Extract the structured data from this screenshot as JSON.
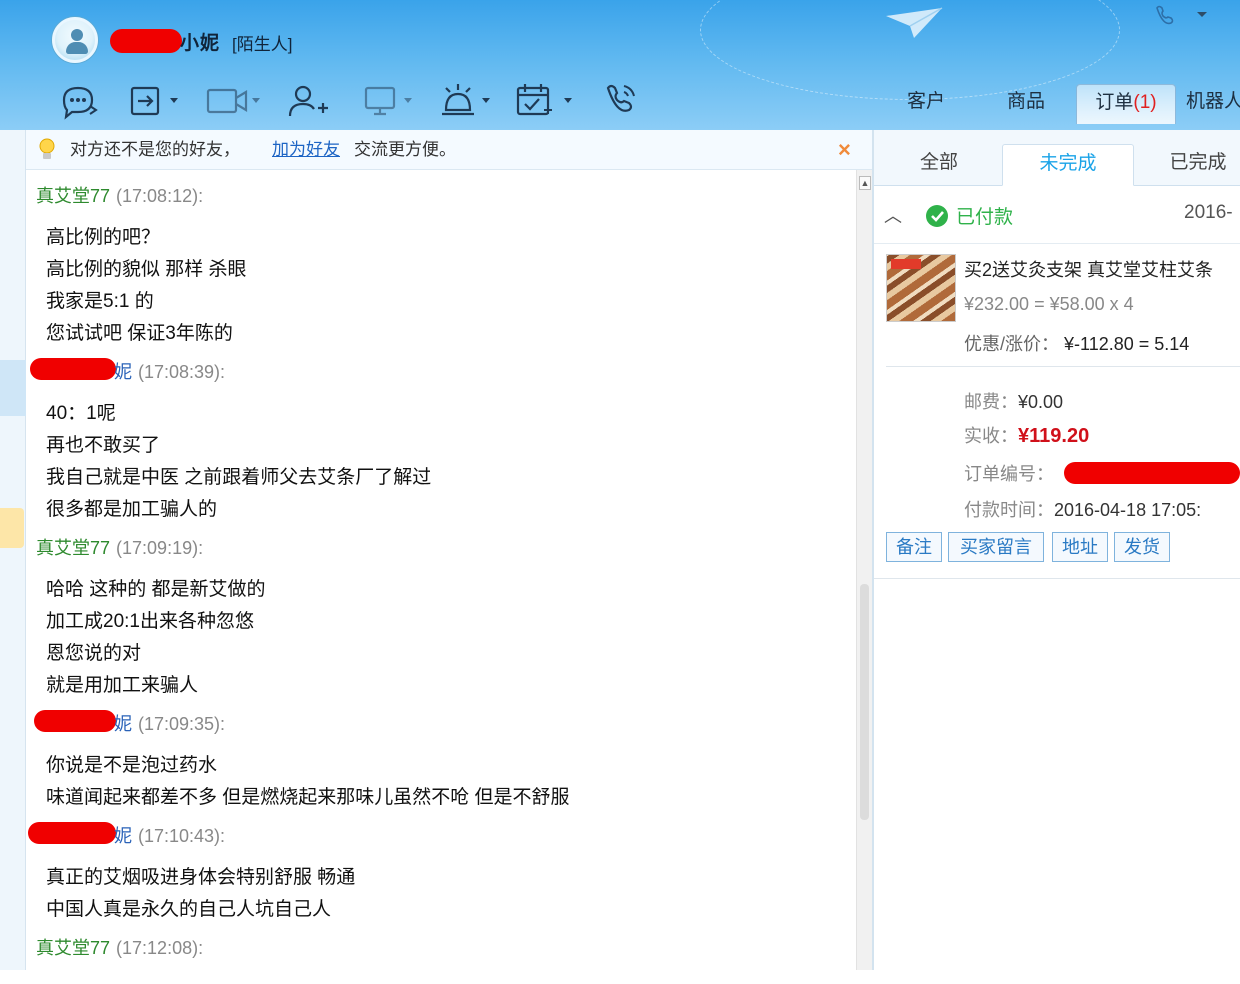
{
  "header": {
    "contact_name": "小妮",
    "contact_tag": "[陌生人]",
    "toolbar_icons": [
      "chat-bubble-icon",
      "file-transfer-icon",
      "video-icon",
      "add-friend-icon",
      "screen-share-icon",
      "remote-assist-icon",
      "schedule-icon",
      "phone-icon"
    ],
    "tabs": [
      {
        "label": "客户"
      },
      {
        "label": "商品"
      },
      {
        "label": "订单",
        "badge": "(1)"
      },
      {
        "label": "机器人"
      }
    ]
  },
  "notice": {
    "text_before": "对方还不是您的好友，",
    "link": "加为好友",
    "text_after": "交流更方便。",
    "close": "×"
  },
  "messages": [
    {
      "sender": "真艾堂77",
      "time": "(17:08:12):",
      "lines": [
        "高比例的吧？",
        "高比例的貌似 那样 杀眼",
        "我家是5:1 的",
        "您试试吧 保证3年陈的"
      ]
    },
    {
      "sender": "妮",
      "time": "(17:08:39):",
      "lines": [
        "40：1呢",
        "再也不敢买了",
        "我自己就是中医 之前跟着师父去艾条厂了解过",
        "很多都是加工骗人的"
      ]
    },
    {
      "sender": "真艾堂77",
      "time": "(17:09:19):",
      "lines": [
        "哈哈 这种的 都是新艾做的",
        "加工成20:1出来各种忽悠",
        "恩您说的对",
        "就是用加工来骗人"
      ]
    },
    {
      "sender": "妮",
      "time": "(17:09:35):",
      "lines": [
        "你说是不是泡过药水",
        "味道闻起来都差不多 但是燃烧起来那味儿虽然不呛 但是不舒服"
      ]
    },
    {
      "sender": "妮",
      "time": "(17:10:43):",
      "lines": [
        "真正的艾烟吸进身体会特别舒服 畅通",
        "中国人真是永久的自己人坑自己人"
      ]
    },
    {
      "sender": "真艾堂77",
      "time": "(17:12:08):",
      "lines": []
    }
  ],
  "order_panel": {
    "subtabs": [
      "全部",
      "未完成",
      "已完成"
    ],
    "status": "已付款",
    "date": "2016-",
    "product_title": "买2送艾灸支架 真艾堂艾柱艾条",
    "price_line": "¥232.00 = ¥58.00 x 4",
    "discount_label": "优惠/涨价：",
    "discount_value": "¥-112.80 = 5.14",
    "postage_label": "邮费：",
    "postage_value": "¥0.00",
    "received_label": "实收：",
    "received_value": "¥119.20",
    "order_no_label": "订单编号：",
    "pay_time_label": "付款时间：",
    "pay_time_value": "2016-04-18 17:05:",
    "actions": [
      "备注",
      "买家留言",
      "地址",
      "发货"
    ]
  },
  "colors": {
    "header_blue": "#3aa3ea",
    "sender_green": "#2e8a2e",
    "sender_blue": "#2a62b8",
    "paid_green": "#2fb24a",
    "price_red": "#d0101a",
    "redaction": "#f00000"
  }
}
